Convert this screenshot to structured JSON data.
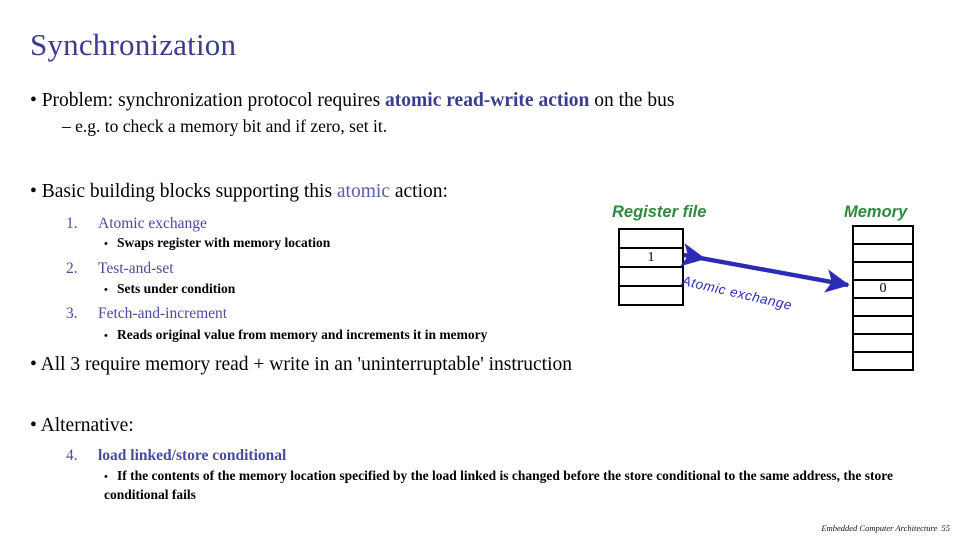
{
  "slide": {
    "title": "Synchronization",
    "accent_color": "#3b3b8f",
    "label_color": "#2e8b3d",
    "arrow_color": "#2b2bb5"
  },
  "bullets": {
    "problem_prefix": "• Problem: synchronization protocol requires ",
    "problem_accent": "atomic read-write action",
    "problem_suffix": " on the bus",
    "problem_sub": "– e.g. to check a memory bit and if zero, set it.",
    "basic_prefix": "• Basic building blocks supporting this ",
    "basic_accent": "atomic",
    "basic_suffix": " action:",
    "all3": "• All 3 require memory read + write in an 'uninterruptable' instruction",
    "alternative": "• Alternative:"
  },
  "numbered": [
    {
      "num": "1.",
      "label": "Atomic exchange",
      "sub": "Swaps register with memory location"
    },
    {
      "num": "2.",
      "label": "Test-and-set",
      "sub": "Sets under condition"
    },
    {
      "num": "3.",
      "label": "Fetch-and-increment",
      "sub": "Reads original value from memory and increments it in memory"
    },
    {
      "num": "4.",
      "label": "load linked/store conditional",
      "sub": "If the contents of the memory location specified by the load linked is changed before the store conditional to the same address, the store conditional fails"
    }
  ],
  "diagram": {
    "register_label": "Register file",
    "memory_label": "Memory",
    "arrow_label": "Atomic exchange",
    "register_cells": [
      "",
      "1",
      "",
      ""
    ],
    "memory_cells": [
      "",
      "",
      "",
      "0",
      "",
      "",
      "",
      ""
    ]
  },
  "footer": {
    "text": "Embedded Computer Architecture",
    "page": "55"
  }
}
